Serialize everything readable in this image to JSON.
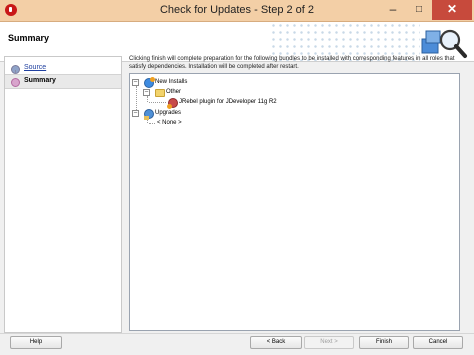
{
  "window": {
    "title": "Check for Updates - Step 2 of 2"
  },
  "header": {
    "title": "Summary"
  },
  "nav": {
    "items": [
      {
        "label": "Source"
      },
      {
        "label": "Summary"
      }
    ]
  },
  "main": {
    "description": "Clicking finish will complete preparation for the following bundles to be installed with corresponding features in all roles that satisfy dependencies. Installation will be completed after restart.",
    "tree": {
      "new_installs": "New Installs",
      "other": "Other",
      "plugin": "JRebel plugin for JDeveloper 11g R2",
      "upgrades": "Upgrades",
      "none": "< None >"
    }
  },
  "buttons": {
    "help": "Help",
    "back": "< Back",
    "next": "Next >",
    "finish": "Finish",
    "cancel": "Cancel"
  },
  "icons": {
    "app": "oracle-jdeveloper-icon",
    "header": "update-search-icon",
    "new_installs": "new-installs-icon",
    "folder": "folder-icon",
    "plugin": "plugin-icon",
    "upgrades": "upgrades-icon"
  }
}
